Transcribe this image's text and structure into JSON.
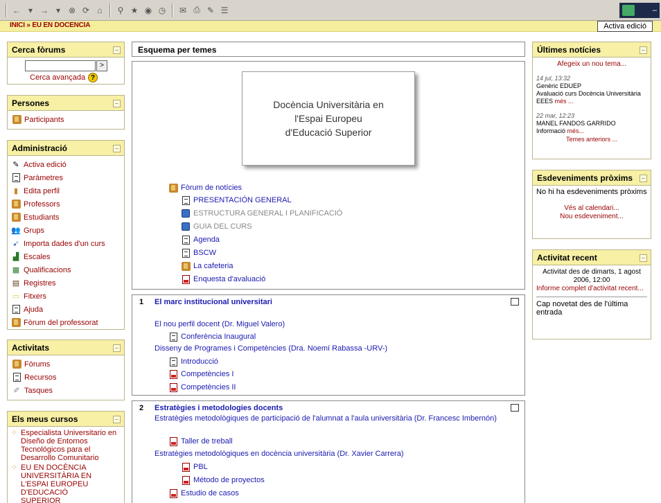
{
  "breadcrumb": {
    "home": "INICI",
    "sep": "»",
    "current": "EU EN DOCENCIA"
  },
  "edit_button": "Activa edició",
  "window_controls": {
    "minimize": "–",
    "restore": "ð"
  },
  "search_forums": {
    "title": "Cerca fòrums",
    "input_value": "",
    "go": ">",
    "advanced": "Cerca avançada",
    "help": "?"
  },
  "people": {
    "title": "Persones",
    "participants": "Participants"
  },
  "admin": {
    "title": "Administració",
    "items": [
      "Activa edició",
      "Paràmetres",
      "Edita perfil",
      "Professors",
      "Estudiants",
      "Grups",
      "Importa dades d'un curs",
      "Escales",
      "Qualificacions",
      "Registres",
      "Fitxers",
      "Ajuda",
      "Fòrum del professorat"
    ]
  },
  "activities": {
    "title": "Activitats",
    "items": [
      "Fòrums",
      "Recursos",
      "Tasques"
    ]
  },
  "my_courses": {
    "title": "Els meus cursos",
    "items": [
      "Especialista Universitario en Diseño de Entornos Tecnológicos para el Desarrollo Comunitario",
      "EU EN DOCÈNCIA UNIVERSITÀRIA EN L'ESPAI EUROPEU D'EDUCACIÓ SUPERIOR"
    ]
  },
  "main": {
    "header": "Esquema per temes",
    "title_lines": [
      "Docència Universitària en",
      "l'Espai Europeu",
      "d'Educació Superior"
    ],
    "resources": [
      {
        "label": "Fòrum de notícies",
        "type": "forum",
        "color": "blue"
      },
      {
        "label": "PRESENTACIÓN GENERAL",
        "type": "doc",
        "color": "blue"
      },
      {
        "label": "ESTRUCTURA GENERAL I PLANIFICACIÓ",
        "type": "web",
        "color": "grey"
      },
      {
        "label": "GUIA DEL CURS",
        "type": "web",
        "color": "grey"
      },
      {
        "label": "Agenda",
        "type": "doc",
        "color": "blue"
      },
      {
        "label": "BSCW",
        "type": "doc",
        "color": "blue"
      },
      {
        "label": "La cafeteria",
        "type": "forum",
        "color": "blue"
      },
      {
        "label": "Enquesta d'avaluació",
        "type": "pdf",
        "color": "blue"
      }
    ],
    "section1": {
      "num": "1",
      "title": "El marc institucional universitari",
      "sub1": "El nou perfil docent (Dr. Miguel Valero)",
      "item1": "Conferència Inaugural",
      "sub2": "Disseny de Programes i Competències (Dra. Noemí Rabassa -URV-)",
      "items2": [
        "Introducció",
        "Competències I",
        "Competències II"
      ]
    },
    "section2": {
      "num": "2",
      "title": "Estratègies i metodologies docents",
      "sub1": "Estratègies metodològiques de participació de l'alumnat a l'aula universitària (Dr. Francesc Imbernón)",
      "item1": "Taller de treball",
      "sub2": "Estratègies metodològiques en docència universitària (Dr. Xavier Carrera)",
      "items2": [
        "PBL",
        "Método de proyectos"
      ],
      "item3": "Estudio de casos"
    }
  },
  "news": {
    "title": "Últimes notícies",
    "add": "Afegeix un nou tema...",
    "entries": [
      {
        "date": "14 jul, 13:32",
        "author": "Genèric EDUEP",
        "text": "Avaluació curs Docència Universitària EEES",
        "more": "més ..."
      },
      {
        "date": "22 mar, 12:23",
        "author": "MANEL FANDOS GARRIDO",
        "text": "Informació",
        "more": "més..."
      }
    ],
    "older": "Temes anteriors ..."
  },
  "events": {
    "title": "Esdeveniments pròxims",
    "none": "No hi ha esdeveniments pròxims",
    "calendar": "Vés al calendari...",
    "new_event": "Nou esdeveniment..."
  },
  "recent": {
    "title": "Activitat recent",
    "since": "Activitat des de dimarts, 1 agost 2006, 12:00",
    "full_report": "Informe complet d'activitat recent...",
    "nothing": "Cap novetat des de l'última entrada"
  }
}
